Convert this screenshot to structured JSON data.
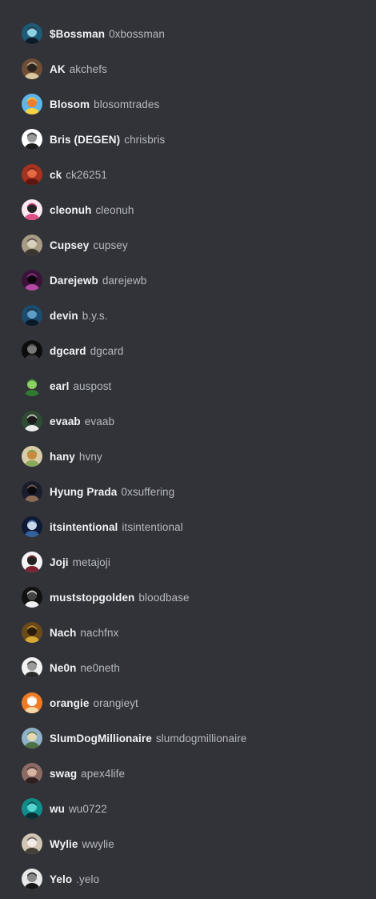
{
  "members": [
    {
      "display_name": "$Bossman",
      "username": "0xbossman",
      "avatar_icon": "bossman-avatar-icon",
      "colors": [
        "#1f5b76",
        "#0c1b25",
        "#8fd0e3"
      ]
    },
    {
      "display_name": "AK",
      "username": "akchefs",
      "avatar_icon": "ak-avatar-icon",
      "colors": [
        "#6f4d36",
        "#d9c69e",
        "#2a221c"
      ]
    },
    {
      "display_name": "Blosom",
      "username": "blosomtrades",
      "avatar_icon": "blosom-avatar-icon",
      "colors": [
        "#5fb6e8",
        "#f5d341",
        "#ef7d2d"
      ]
    },
    {
      "display_name": "Bris (DEGEN)",
      "username": "chrisbris",
      "avatar_icon": "bris-avatar-icon",
      "colors": [
        "#ffffff",
        "#1d1d1d",
        "#999999"
      ]
    },
    {
      "display_name": "ck",
      "username": "ck26251",
      "avatar_icon": "ck-avatar-icon",
      "colors": [
        "#a7321f",
        "#5c1511",
        "#e36c43"
      ]
    },
    {
      "display_name": "cleonuh",
      "username": "cleonuh",
      "avatar_icon": "cleonuh-avatar-icon",
      "colors": [
        "#fbe8f0",
        "#e14e86",
        "#222222"
      ]
    },
    {
      "display_name": "Cupsey",
      "username": "cupsey",
      "avatar_icon": "cupsey-avatar-icon",
      "colors": [
        "#a99c84",
        "#3a352e",
        "#d9cfbd"
      ]
    },
    {
      "display_name": "Darejewb",
      "username": "darejewb",
      "avatar_icon": "darejewb-avatar-icon",
      "colors": [
        "#3b1238",
        "#b04aa4",
        "#0d060c"
      ]
    },
    {
      "display_name": "devin",
      "username": "b.y.s.",
      "avatar_icon": "devin-avatar-icon",
      "colors": [
        "#1b4b6d",
        "#0a1a28",
        "#5f9cc6"
      ]
    },
    {
      "display_name": "dgcard",
      "username": "dgcard",
      "avatar_icon": "dgcard-avatar-icon",
      "colors": [
        "#0c0c0d",
        "#39393d",
        "#777777"
      ]
    },
    {
      "display_name": "earl",
      "username": "auspost",
      "avatar_icon": "earl-avatar-icon",
      "colors": [
        "#313338",
        "#2f7c31",
        "#8ccf63"
      ]
    },
    {
      "display_name": "evaab",
      "username": "evaab",
      "avatar_icon": "evaab-avatar-icon",
      "colors": [
        "#2f4b34",
        "#eaeaea",
        "#1a1a1a"
      ]
    },
    {
      "display_name": "hany",
      "username": "hvny",
      "avatar_icon": "hany-avatar-icon",
      "colors": [
        "#d8cda8",
        "#8aa75a",
        "#c48a3d"
      ]
    },
    {
      "display_name": "Hyung Prada",
      "username": "0xsuffering",
      "avatar_icon": "hyung-prada-avatar-icon",
      "colors": [
        "#1a1d2e",
        "#8b6b56",
        "#0a0b12"
      ]
    },
    {
      "display_name": "itsintentional",
      "username": "itsintentional",
      "avatar_icon": "itsintentional-avatar-icon",
      "colors": [
        "#0f1a35",
        "#36619b",
        "#c9d8ea"
      ]
    },
    {
      "display_name": "Joji",
      "username": "metajoji",
      "avatar_icon": "joji-avatar-icon",
      "colors": [
        "#f4f4f4",
        "#7d2131",
        "#232323"
      ]
    },
    {
      "display_name": "muststopgolden",
      "username": "bloodbase",
      "avatar_icon": "muststopgolden-avatar-icon",
      "colors": [
        "#111111",
        "#f0f0f0",
        "#444444"
      ]
    },
    {
      "display_name": "Nach",
      "username": "nachfnx",
      "avatar_icon": "nach-avatar-icon",
      "colors": [
        "#6c4a19",
        "#d8a936",
        "#2b1d0d"
      ]
    },
    {
      "display_name": "Ne0n",
      "username": "ne0neth",
      "avatar_icon": "ne0n-avatar-icon",
      "colors": [
        "#f2f2f2",
        "#2a2a2a",
        "#9a9a9a"
      ]
    },
    {
      "display_name": "orangie",
      "username": "orangieyt",
      "avatar_icon": "orangie-avatar-icon",
      "colors": [
        "#f07b25",
        "#fcd5a7",
        "#ffffff"
      ]
    },
    {
      "display_name": "SlumDogMillionaire",
      "username": "slumdogmillionaire",
      "avatar_icon": "slumdog-avatar-icon",
      "colors": [
        "#8fb2c8",
        "#4d6f43",
        "#e4d9b5"
      ]
    },
    {
      "display_name": "swag",
      "username": "apex4life",
      "avatar_icon": "swag-avatar-icon",
      "colors": [
        "#8c6b63",
        "#2e1f20",
        "#d7b4a2"
      ]
    },
    {
      "display_name": "wu",
      "username": "wu0722",
      "avatar_icon": "wu-avatar-icon",
      "colors": [
        "#0f8e8c",
        "#0b2e33",
        "#54d5cf"
      ]
    },
    {
      "display_name": "Wylie",
      "username": "wwylie",
      "avatar_icon": "wylie-avatar-icon",
      "colors": [
        "#d1c5b4",
        "#474039",
        "#f1ece4"
      ]
    },
    {
      "display_name": "Yelo",
      "username": ".yelo",
      "avatar_icon": "yelo-avatar-icon",
      "colors": [
        "#e8e8e8",
        "#171717",
        "#888888"
      ]
    }
  ]
}
